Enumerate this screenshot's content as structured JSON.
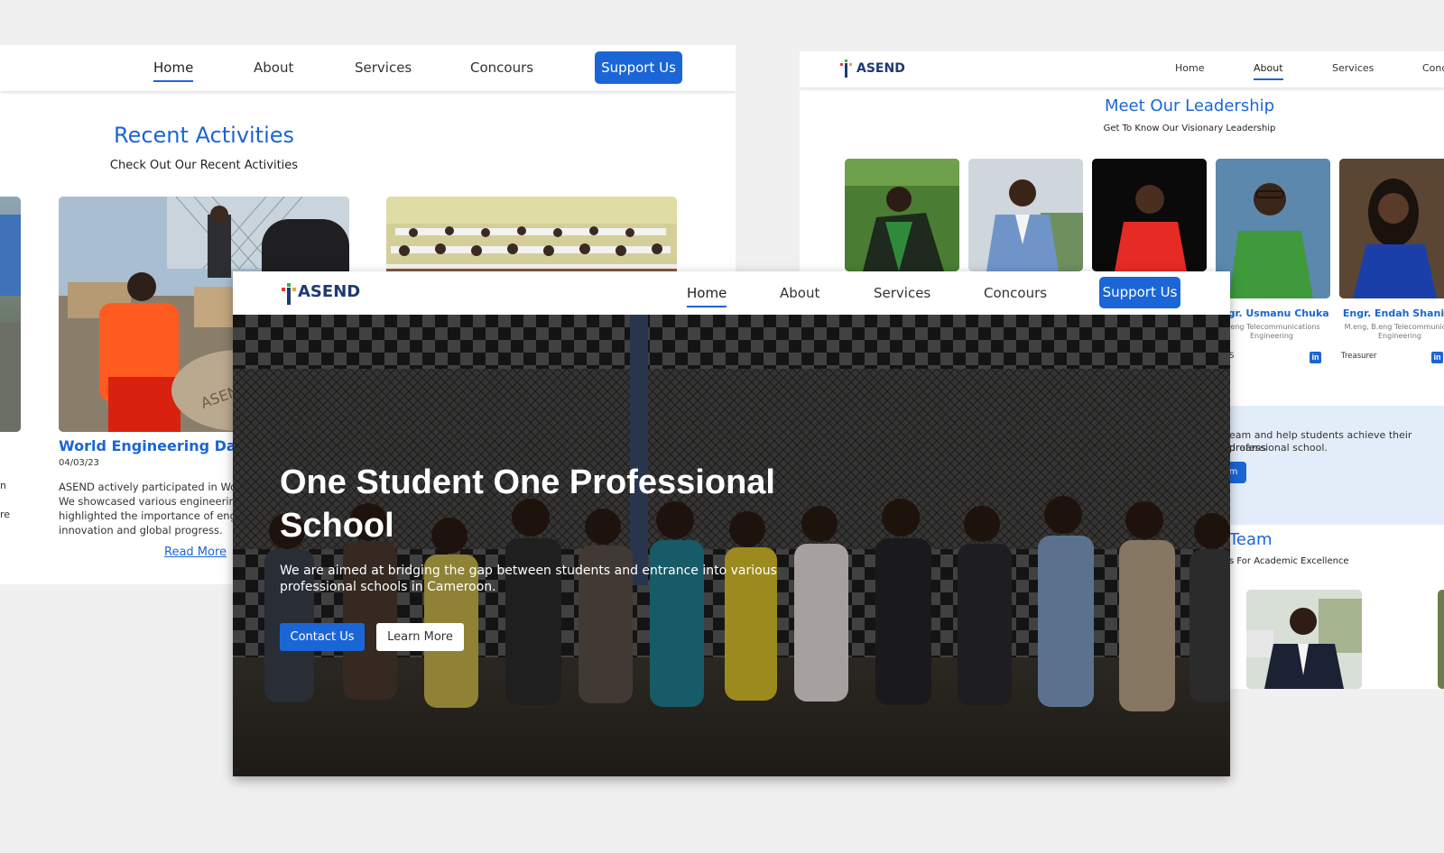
{
  "activities_page": {
    "nav": {
      "home": "Home",
      "about": "About",
      "services": "Services",
      "concours": "Concours",
      "support": "Support Us"
    },
    "title": "Recent Activities",
    "subtitle": "Check Out Our Recent Activities",
    "left_edge_text": [
      "n",
      "re"
    ],
    "activity": {
      "title": "World Engineering Day",
      "date": "04/03/23",
      "lines": [
        "ASEND actively participated in Wo",
        "We showcased various engineerin",
        "highlighted the importance of eng",
        "innovation and global progress."
      ],
      "read_more": "Read More"
    }
  },
  "leadership_page": {
    "logo": "ASEND",
    "nav": {
      "home": "Home",
      "about": "About",
      "services": "Services",
      "concours": "Conc"
    },
    "title": "Meet Our Leadership",
    "subtitle": "Get To Know Our Visionary Leadership",
    "leaders": [
      {
        "name": "Engr. Usmanu Chuka",
        "degree_line1": "B.eng Telecommunications",
        "degree_line2": "Engineering",
        "role": "S"
      },
      {
        "name": "Engr. Endah Shanice",
        "degree_line1": "M.eng, B.eng Telecommunicati",
        "degree_line2": "Engineering",
        "role": "Treasurer"
      }
    ],
    "linkedin_label": "in",
    "band_line1": "eam and help students achieve their dreams",
    "band_line2": "professional school.",
    "band_button": "am",
    "team_title": "Team",
    "team_subtitle": "s For Academic Excellence"
  },
  "home_page": {
    "logo": "ASEND",
    "nav": {
      "home": "Home",
      "about": "About",
      "services": "Services",
      "concours": "Concours",
      "support": "Support Us"
    },
    "hero_title_line1": "One Student One Professional",
    "hero_title_line2": "School",
    "hero_sub_line1": "We are aimed at bridging the gap between students and entrance into various",
    "hero_sub_line2": "professional schools in Cameroon.",
    "contact_button": "Contact Us",
    "learn_button": "Learn More"
  },
  "colors": {
    "accent": "#1a66d6",
    "logo_text": "#1d3a73",
    "band": "#e3edf9"
  }
}
